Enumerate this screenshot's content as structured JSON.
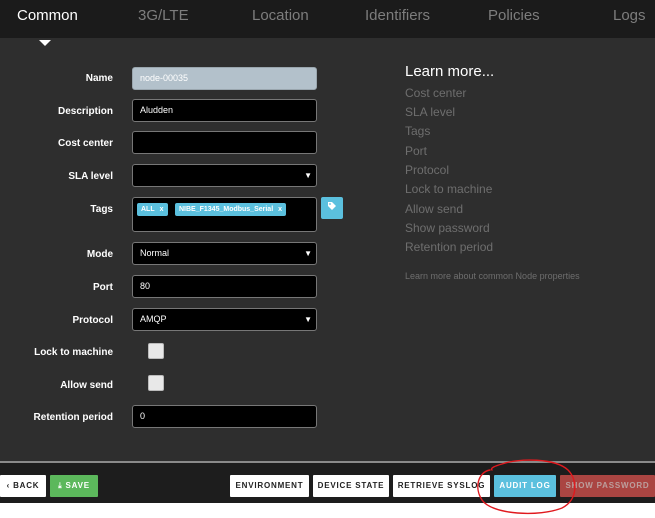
{
  "tabs": [
    {
      "label": "Common",
      "active": true
    },
    {
      "label": "3G/LTE",
      "active": false
    },
    {
      "label": "Location",
      "active": false
    },
    {
      "label": "Identifiers",
      "active": false
    },
    {
      "label": "Policies",
      "active": false
    },
    {
      "label": "Logs",
      "active": false
    }
  ],
  "form": {
    "name": {
      "label": "Name",
      "value": "node-00035"
    },
    "description": {
      "label": "Description",
      "value": "Aludden"
    },
    "cost_center": {
      "label": "Cost center",
      "value": ""
    },
    "sla_level": {
      "label": "SLA level",
      "value": ""
    },
    "tags": {
      "label": "Tags",
      "items": [
        "ALL",
        "NIBE_F1345_Modbus_Serial"
      ],
      "remove_symbol": "x",
      "add_icon": "tag-icon"
    },
    "mode": {
      "label": "Mode",
      "value": "Normal"
    },
    "port": {
      "label": "Port",
      "value": "80"
    },
    "protocol": {
      "label": "Protocol",
      "value": "AMQP"
    },
    "lock_to_machine": {
      "label": "Lock to machine",
      "checked": false
    },
    "allow_send": {
      "label": "Allow send",
      "checked": false
    },
    "retention_period": {
      "label": "Retention period",
      "value": "0"
    }
  },
  "learn": {
    "title": "Learn more...",
    "items": [
      "Cost center",
      "SLA level",
      "Tags",
      "Port",
      "Protocol",
      "Lock to machine",
      "Allow send",
      "Show password",
      "Retention period"
    ],
    "link": "Learn more about common Node properties"
  },
  "footer": {
    "back": {
      "label": "BACK",
      "icon": "chevron-left-icon"
    },
    "save": {
      "label": "SAVE",
      "icon": "download-icon"
    },
    "environment": "ENVIRONMENT",
    "device_state": "DEVICE STATE",
    "retrieve_syslog": "RETRIEVE SYSLOG",
    "audit_log": "AUDIT LOG",
    "show_password": "SHOW PASSWORD"
  },
  "colors": {
    "tab_bar": "#1b1b1b",
    "panel": "#2e2e2e",
    "accent_blue": "#5bc0de",
    "save_green": "#5cb85c",
    "danger_red": "#d9534f",
    "annotation_red": "#e0191e"
  }
}
